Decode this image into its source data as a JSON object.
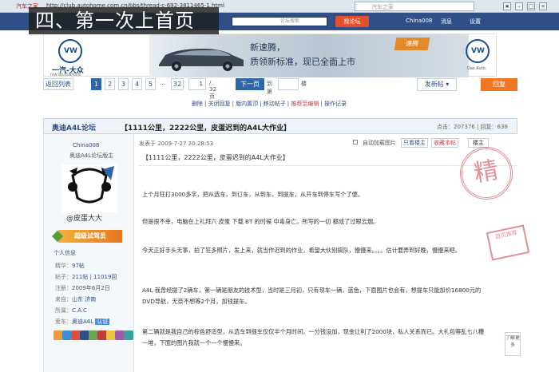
{
  "browser": {
    "tab_title": "汽车之家",
    "url": "http://club.autohome.com.cn/bbs/thread-c-692-3811465-1.html",
    "search_placeholder": "汽车之家"
  },
  "site_nav": {
    "search_button": "论坛搜索",
    "hot_button": "找论坛",
    "username": "China008",
    "messages": "消息",
    "settings": "设置"
  },
  "overlay_title": "四、第一次上首页",
  "banner": {
    "brand": "一汽-大众",
    "brand_sub": "FAW-VOLKSWAGEN",
    "slogan_line1": "新速腾，",
    "slogan_line2": "质领新标准，现已全面上市",
    "badge": "速腾",
    "right_label": "Das Auto."
  },
  "pagination": {
    "back_label": "返回列表",
    "pages": [
      "1",
      "2",
      "3",
      "4",
      "5",
      "...",
      "32"
    ],
    "current_page": "1",
    "total_pages": "/ 32 页",
    "next_label": "下一页",
    "goto_label": "到第",
    "goto_suffix": "楼",
    "post_button": "发新帖",
    "reply_button": "回复"
  },
  "admin_links": [
    "删除",
    "关闭回复",
    "版内置顶",
    "移动帖子",
    "推荐至编辑",
    "操作记录"
  ],
  "thread": {
    "forum_name": "奥迪A4L论坛",
    "title": "【1111公里，2222公里，皮蛋迟到的A4L大作业】",
    "stats": "点击：207376 | 回复：638"
  },
  "user": {
    "username": "China008",
    "role": "奥迪A4L论坛版主",
    "handle": "@皮蛋大大",
    "tag": "超级试驾员",
    "info_label": "个人信息",
    "rows": [
      {
        "label": "精华：",
        "value": "97帖"
      },
      {
        "label": "帖子：",
        "value": "211帖 | 11019回"
      },
      {
        "label": "注册：",
        "value": "2009年6月2日"
      },
      {
        "label": "来自：",
        "value": "山东 济南"
      },
      {
        "label": "所属：",
        "value": "C.A.C"
      },
      {
        "label": "爱车：",
        "value": "奥迪A4L",
        "badge": "认证"
      }
    ],
    "medal_colors": [
      "#f29a2e",
      "#3c8fd6",
      "#e44c3c",
      "#2f4f86",
      "#6aa84f",
      "#c23b3b",
      "#e8c43a",
      "#a05aa8",
      "#3aa0a0"
    ]
  },
  "post": {
    "meta": "发表于 2009-7-27 20:28:53",
    "autoload_label": "自动加载图片",
    "only_author_button": "只看楼主",
    "favorite_button": "收藏本帖",
    "floor_label": "楼主",
    "title": "【1111公里，2222公里，皮蛋迟到的A4L大作业】",
    "paragraphs": [
      "上个月狂打3000多字，把从选车，到订车，从到车，到提车，从开车到停车写个了便。",
      "但是很不幸，电脑在上礼拜六 皮蛋 下载 BT 的时候  中毒身亡。所写的一切 都成了过眼云烟。",
      "今天正好手头无事，拍了狂多照片，发上来，就当作迟到的作业，希望大伙别搞队，慢慢来。。。。估计要弄到好晚，慢慢来吧。",
      "A4L 我曾经提了2辆车，第一辆是朋友的技术型，当时是三月初，只有现车一辆，蓝色，下面图片也会有，想提车只能加价16800元的DVD导航，无奈不想等2个月，加钱提车。",
      "第二辆就是我自己的棕色舒适型，从选车到提车仅仅半个月时间，一分钱没加，现金让利了2000块，私人关系而已。大礼包等乱七八糟一堆，下面的图片我就一个一个慢慢来。"
    ],
    "stamp_text": "精",
    "stamp2_text": "首页推荐",
    "side_help": "了解更多"
  }
}
